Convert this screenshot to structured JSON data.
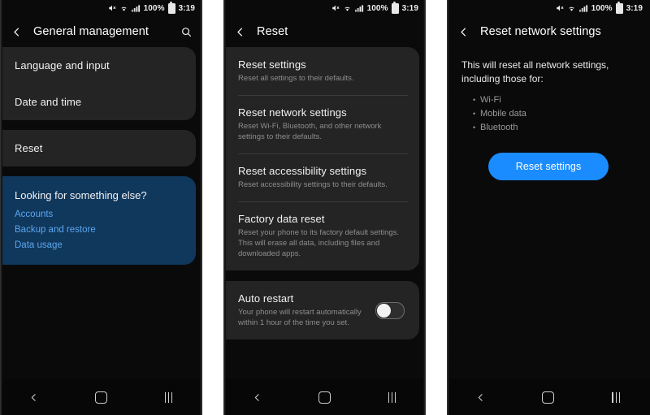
{
  "status_bar": {
    "mute_icon": "mute-icon",
    "wifi_icon": "wifi-icon",
    "signal_icon": "signal-bars-icon",
    "battery_percent": "100%",
    "battery_icon": "battery-icon",
    "time": "3:19"
  },
  "colors": {
    "page_background": "#0a0a0a",
    "card_background": "#242424",
    "promo_background": "#10375c",
    "promo_link": "#5aa7ef",
    "accent_button": "#1a8cff"
  },
  "nav_bar": {
    "back_label": "back-icon",
    "home_label": "home-icon",
    "recents_label": "recents-icon"
  },
  "panel1": {
    "appbar": {
      "back_icon": "back-chevron-icon",
      "title": "General management",
      "search_icon": "search-icon"
    },
    "group1": [
      {
        "title": "Language and input"
      },
      {
        "title": "Date and time"
      }
    ],
    "group2": [
      {
        "title": "Reset"
      }
    ],
    "promo": {
      "title": "Looking for something else?",
      "links": [
        "Accounts",
        "Backup and restore",
        "Data usage"
      ]
    }
  },
  "panel2": {
    "appbar": {
      "back_icon": "back-chevron-icon",
      "title": "Reset"
    },
    "items": [
      {
        "title": "Reset settings",
        "subtitle": "Reset all settings to their defaults."
      },
      {
        "title": "Reset network settings",
        "subtitle": "Reset Wi-Fi, Bluetooth, and other network settings to their defaults."
      },
      {
        "title": "Reset accessibility settings",
        "subtitle": "Reset accessibility settings to their defaults."
      },
      {
        "title": "Factory data reset",
        "subtitle": "Reset your phone to its factory default settings. This will erase all data, including files and downloaded apps."
      }
    ],
    "auto_restart": {
      "title": "Auto restart",
      "subtitle": "Your phone will restart automatically within 1 hour of the time you set.",
      "toggle_state": "off"
    }
  },
  "panel3": {
    "appbar": {
      "back_icon": "back-chevron-icon",
      "title": "Reset network settings"
    },
    "lead": "This will reset all network settings, including those for:",
    "bullets": [
      "Wi-Fi",
      "Mobile data",
      "Bluetooth"
    ],
    "button_label": "Reset settings"
  }
}
